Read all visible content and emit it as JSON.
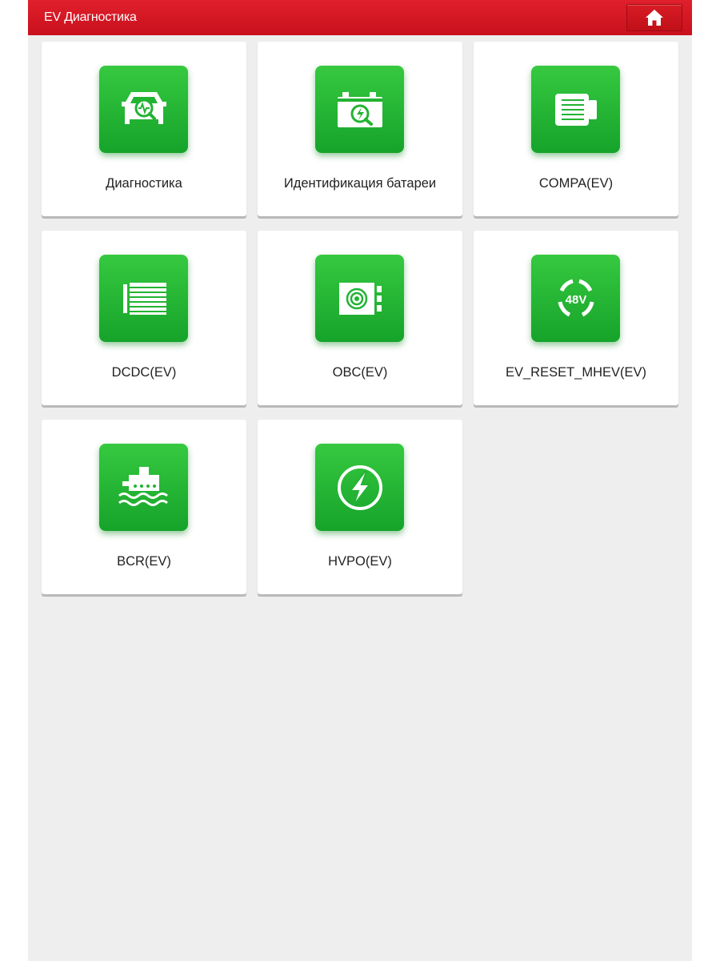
{
  "header": {
    "title": "EV Диагностика",
    "home_icon": "home-icon"
  },
  "colors": {
    "header_red": "#d4141f",
    "icon_green": "#22b333",
    "background": "#eeeeee"
  },
  "tiles": [
    {
      "label": "Диагностика",
      "icon": "car-diagnostics-icon"
    },
    {
      "label": "Идентификация батареи",
      "icon": "battery-search-icon"
    },
    {
      "label": "COMPA(EV)",
      "icon": "compressor-icon"
    },
    {
      "label": "DCDC(EV)",
      "icon": "dcdc-converter-icon"
    },
    {
      "label": "OBC(EV)",
      "icon": "onboard-charger-icon"
    },
    {
      "label": "EV_RESET_MHEV(EV)",
      "icon": "48v-reset-icon"
    },
    {
      "label": "BCR(EV)",
      "icon": "coolant-temperature-icon"
    },
    {
      "label": "HVPO(EV)",
      "icon": "high-voltage-power-icon"
    }
  ]
}
